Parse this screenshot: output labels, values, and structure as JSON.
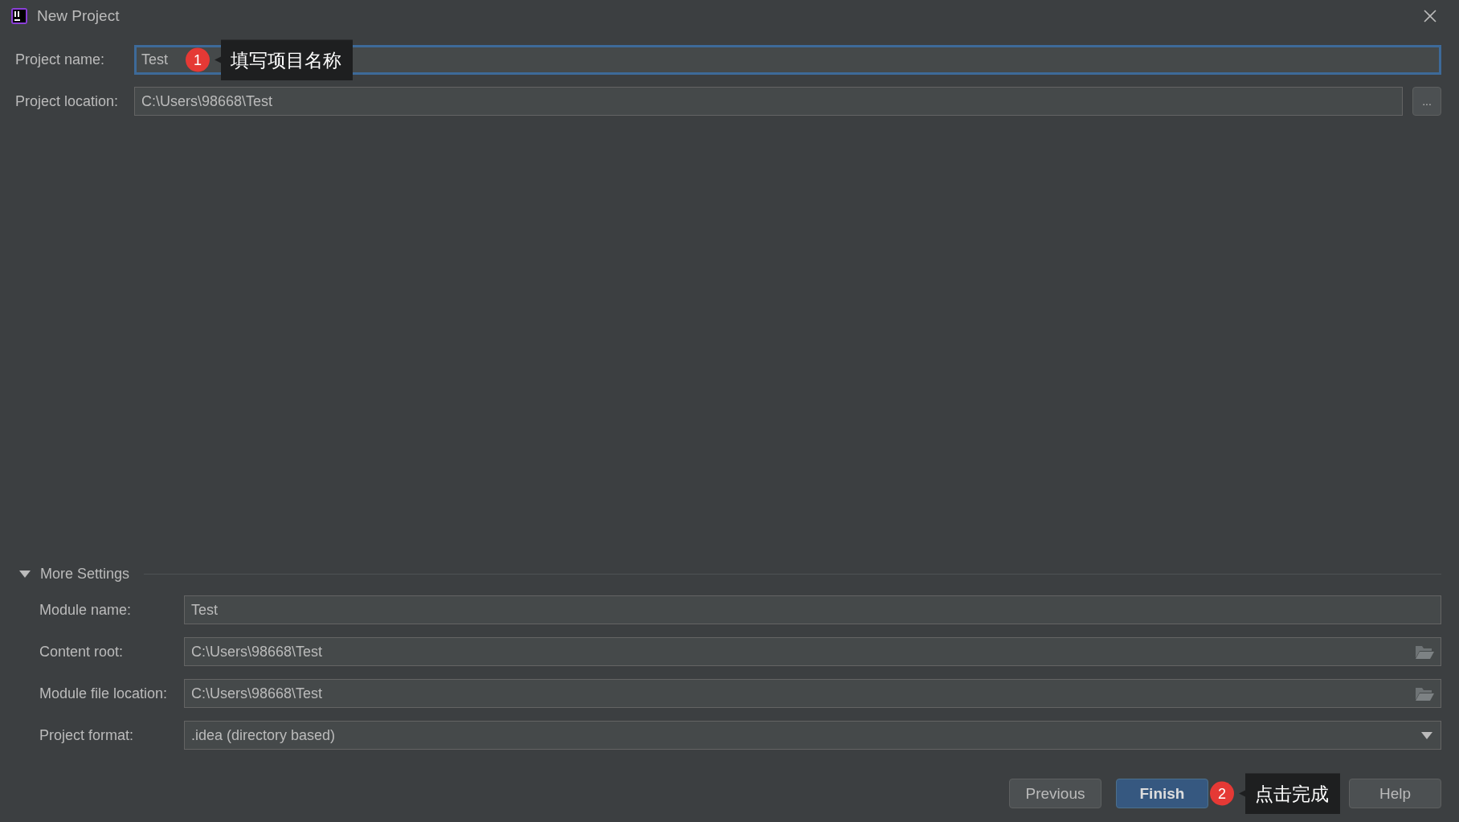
{
  "window": {
    "title": "New Project"
  },
  "fields": [
    {
      "kind": "text",
      "label": "Project name:",
      "value": "Test",
      "focused": true,
      "annotation": {
        "number": "1",
        "text": "填写项目名称"
      }
    },
    {
      "kind": "browse",
      "label": "Project location:",
      "value": "C:\\Users\\98668\\Test",
      "focused": false,
      "button": "..."
    }
  ],
  "more_settings": {
    "label": "More Settings",
    "expanded": true,
    "fields": [
      {
        "kind": "text",
        "label": "Module name:",
        "value": "Test",
        "focused": false
      },
      {
        "kind": "folder",
        "label": "Content root:",
        "value": "C:\\Users\\98668\\Test",
        "focused": false
      },
      {
        "kind": "folder",
        "label": "Module file location:",
        "value": "C:\\Users\\98668\\Test",
        "focused": false
      },
      {
        "kind": "dropdown",
        "label": "Project format:",
        "value": ".idea (directory based)",
        "focused": false
      }
    ]
  },
  "buttons": [
    {
      "label": "Previous",
      "default": false
    },
    {
      "label": "Finish",
      "default": true,
      "annotation": {
        "number": "2",
        "text": "点击完成"
      }
    },
    {
      "label": "Help",
      "default": false
    }
  ]
}
